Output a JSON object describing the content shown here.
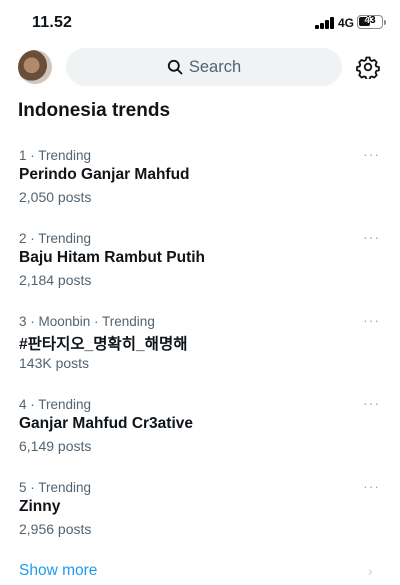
{
  "status": {
    "time": "11.52",
    "network": "4G",
    "battery": "43"
  },
  "header": {
    "search_placeholder": "Search",
    "avatar_icon": "user-avatar",
    "settings_icon": "gear-icon"
  },
  "section_title": "Indonesia trends",
  "trends": [
    {
      "meta": "1 · Trending",
      "name": "Perindo Ganjar Mahfud",
      "posts": "2,050 posts"
    },
    {
      "meta": "2 · Trending",
      "name": "Baju Hitam Rambut Putih",
      "posts": "2,184 posts"
    },
    {
      "meta": "3 · Moonbin · Trending",
      "name": "#판타지오_명확히_해명해",
      "posts": "143K posts"
    },
    {
      "meta": "4 · Trending",
      "name": "Ganjar Mahfud Cr3ative",
      "posts": "6,149 posts"
    },
    {
      "meta": "5 · Trending",
      "name": "Zinny",
      "posts": "2,956 posts"
    }
  ],
  "more_glyph": "···",
  "show_more": "Show more",
  "accent_color": "#1d9bf0"
}
